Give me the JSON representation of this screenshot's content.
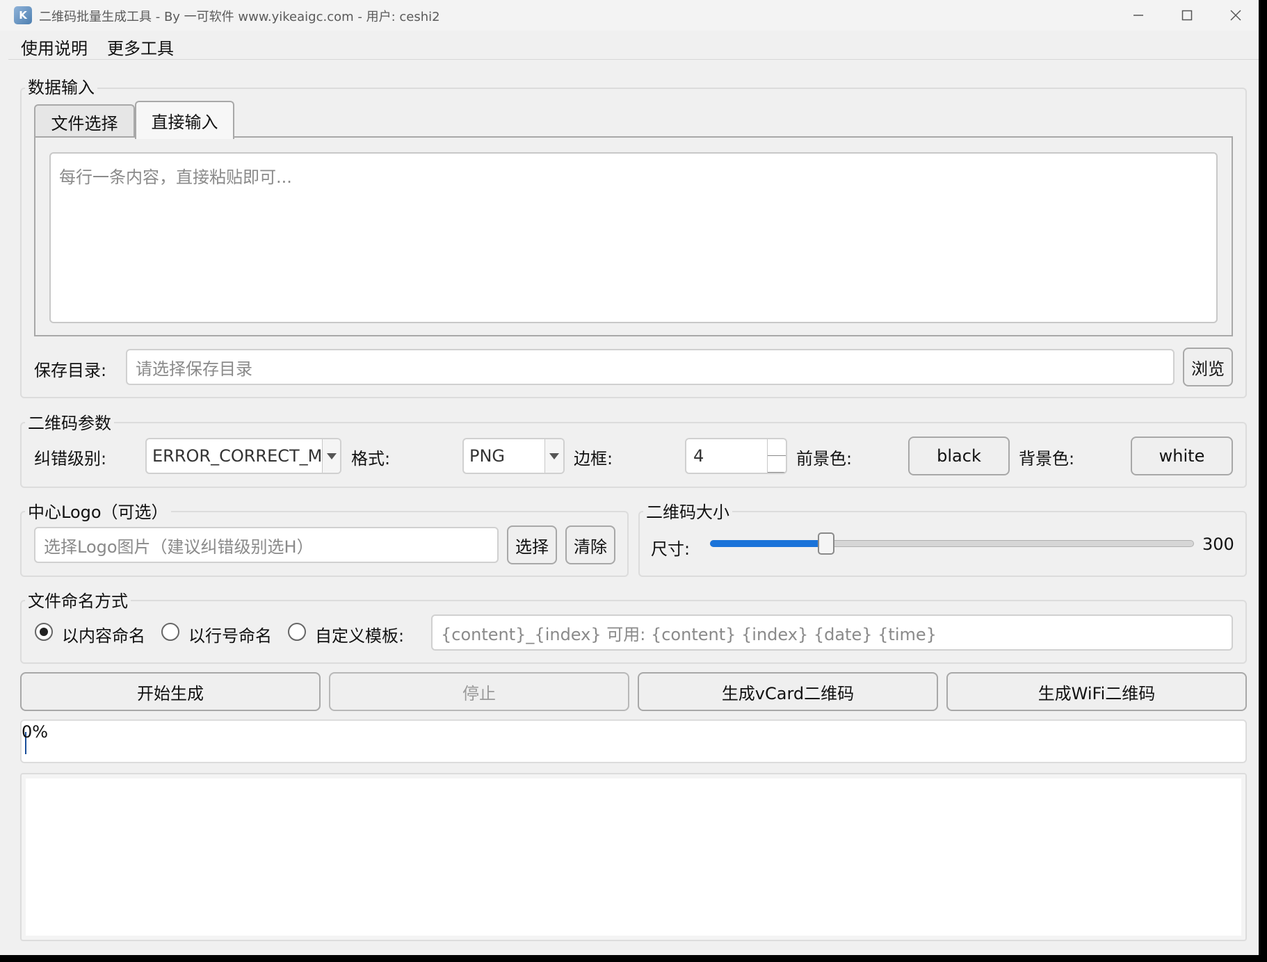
{
  "window": {
    "title": "二维码批量生成工具 - By 一可软件 www.yikeaigc.com - 用户: ceshi2"
  },
  "menu": {
    "items": [
      "使用说明",
      "更多工具"
    ]
  },
  "data_input": {
    "group_title": "数据输入",
    "tabs": [
      "文件选择",
      "直接输入"
    ],
    "active_tab": "直接输入",
    "textarea_placeholder": "每行一条内容，直接粘贴即可...",
    "save_dir_label": "保存目录:",
    "save_dir_placeholder": "请选择保存目录",
    "browse_button": "浏览"
  },
  "qr_params": {
    "group_title": "二维码参数",
    "error_level_label": "纠错级别:",
    "error_level_value": "ERROR_CORRECT_M",
    "format_label": "格式:",
    "format_value": "PNG",
    "border_label": "边框:",
    "border_value": "4",
    "fg_label": "前景色:",
    "fg_button": "black",
    "bg_label": "背景色:",
    "bg_button": "white"
  },
  "logo": {
    "group_title": "中心Logo（可选）",
    "placeholder": "选择Logo图片（建议纠错级别选H）",
    "select_button": "选择",
    "clear_button": "清除"
  },
  "size": {
    "group_title": "二维码大小",
    "label": "尺寸:",
    "value": "300",
    "slider_fraction": 0.23
  },
  "naming": {
    "group_title": "文件命名方式",
    "options": [
      "以内容命名",
      "以行号命名",
      "自定义模板:"
    ],
    "selected_index": 0,
    "template_placeholder": "{content}_{index}  可用: {content} {index} {date} {time}"
  },
  "actions": {
    "start": "开始生成",
    "stop": "停止",
    "vcard": "生成vCard二维码",
    "wifi": "生成WiFi二维码"
  },
  "progress": {
    "text": "0%",
    "value": 0
  },
  "log": {
    "text": ""
  },
  "colors": {
    "accent": "#1a73d9",
    "window_bg": "#f0f0f0"
  }
}
